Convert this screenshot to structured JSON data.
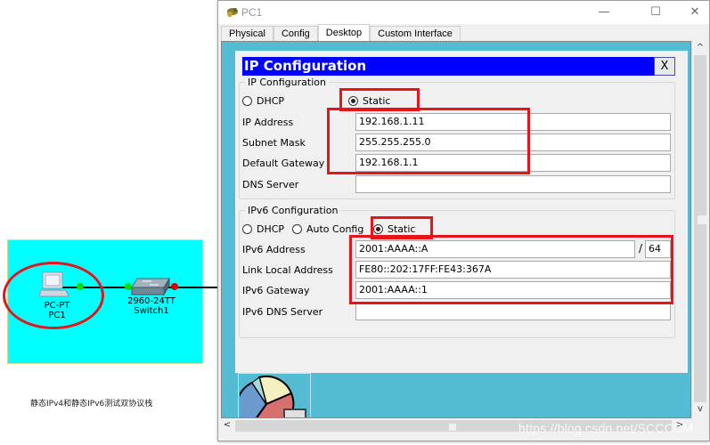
{
  "topology": {
    "devices": [
      {
        "model": "PC-PT",
        "name": "PC1"
      },
      {
        "model": "2960-24TT",
        "name": "Switch1"
      }
    ],
    "link_status_colors": {
      "up": "#00e000",
      "down": "#e00000"
    },
    "note": "静态IPv4和静态IPv6测试双协议栈"
  },
  "window": {
    "title": "PC1",
    "controls": {
      "minimize": "—",
      "maximize": "☐",
      "close": "✕"
    },
    "tabs": [
      {
        "label": "Physical",
        "active": false
      },
      {
        "label": "Config",
        "active": false
      },
      {
        "label": "Desktop",
        "active": true
      },
      {
        "label": "Custom Interface",
        "active": false
      }
    ]
  },
  "ip_dialog": {
    "title": "IP Configuration",
    "close_label": "X",
    "ipv4": {
      "legend": "IP Configuration",
      "modes": [
        {
          "label": "DHCP",
          "selected": false
        },
        {
          "label": "Static",
          "selected": true
        }
      ],
      "fields": [
        {
          "label": "IP Address",
          "value": "192.168.1.11"
        },
        {
          "label": "Subnet Mask",
          "value": "255.255.255.0"
        },
        {
          "label": "Default Gateway",
          "value": "192.168.1.1"
        },
        {
          "label": "DNS Server",
          "value": ""
        }
      ]
    },
    "ipv6": {
      "legend": "IPv6 Configuration",
      "modes": [
        {
          "label": "DHCP",
          "selected": false
        },
        {
          "label": "Auto Config",
          "selected": false
        },
        {
          "label": "Static",
          "selected": true
        }
      ],
      "fields": [
        {
          "label": "IPv6 Address",
          "value": "2001:AAAA::A",
          "prefix_sep": "/",
          "prefix": "64"
        },
        {
          "label": "Link Local Address",
          "value": "FE80::202:17FF:FE43:367A"
        },
        {
          "label": "IPv6 Gateway",
          "value": "2001:AAAA::1"
        },
        {
          "label": "IPv6 DNS Server",
          "value": ""
        }
      ]
    }
  },
  "annotation_color": "#e8141c",
  "scrollbar": {
    "up": "^",
    "down": "v",
    "left": "<",
    "right": ">"
  },
  "watermark": "https://blog.csdn.net/SCCCCM"
}
